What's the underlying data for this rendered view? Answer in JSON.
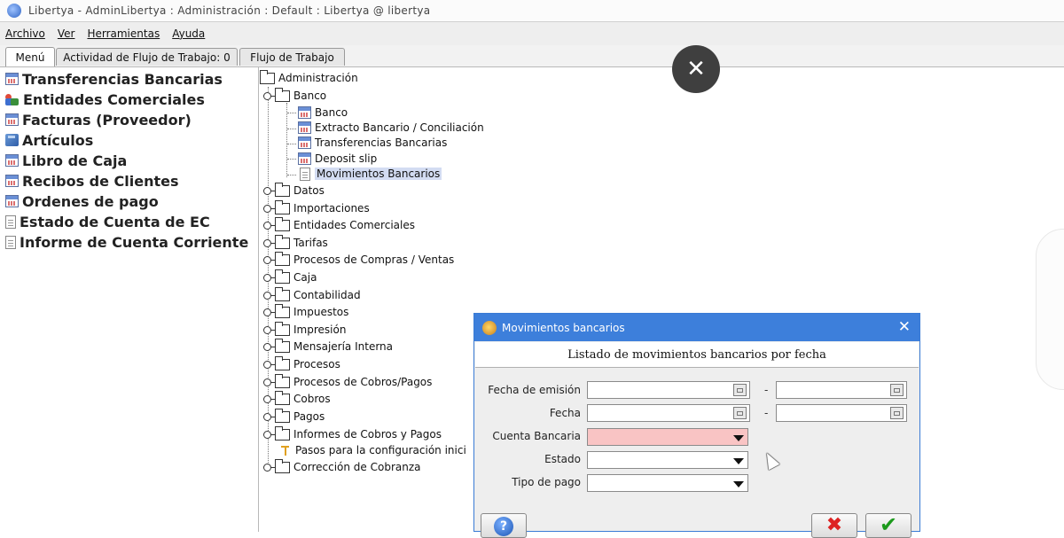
{
  "window": {
    "title": "Libertya    -    AdminLibertya : Administración : Default : Libertya @ libertya"
  },
  "menubar": {
    "items": [
      "Archivo",
      "Ver",
      "Herramientas",
      "Ayuda"
    ]
  },
  "tabs": [
    {
      "label": "Menú",
      "active": true
    },
    {
      "label": "Actividad de Flujo de Trabajo: 0",
      "active": false
    },
    {
      "label": "Flujo de Trabajo",
      "active": false
    }
  ],
  "favorites": [
    {
      "label": "Transferencias Bancarias",
      "icon": "window-icon"
    },
    {
      "label": "Entidades Comerciales",
      "icon": "entities-icon"
    },
    {
      "label": "Facturas (Proveedor)",
      "icon": "window-icon"
    },
    {
      "label": "Artículos",
      "icon": "product-icon"
    },
    {
      "label": "Libro de Caja",
      "icon": "window-icon"
    },
    {
      "label": "Recibos de Clientes",
      "icon": "window-icon"
    },
    {
      "label": "Ordenes de pago",
      "icon": "window-icon"
    },
    {
      "label": "Estado de Cuenta de EC",
      "icon": "report-icon"
    },
    {
      "label": "Informe de Cuenta Corriente",
      "icon": "report-icon"
    }
  ],
  "tree": {
    "root": "Administración",
    "banco": {
      "label": "Banco",
      "children": [
        "Banco",
        "Extracto Bancario / Conciliación",
        "Transferencias Bancarias",
        "Deposit slip",
        "Movimientos Bancarios"
      ]
    },
    "folders": [
      "Datos",
      "Importaciones",
      "Entidades Comerciales",
      "Tarifas",
      "Procesos de Compras / Ventas",
      "Caja",
      "Contabilidad",
      "Impuestos",
      "Impresión",
      "Mensajería Interna",
      "Procesos",
      "Procesos de Cobros/Pagos",
      "Cobros",
      "Pagos",
      "Informes de Cobros y Pagos"
    ],
    "pasos": "Pasos para la configuración inici",
    "correccion": "Corrección de Cobranza"
  },
  "overlay": {
    "close_glyph": "✕"
  },
  "dialog": {
    "title": "Movimientos bancarios",
    "close_glyph": "✕",
    "header": "Listado de movimientos bancarios por fecha",
    "labels": {
      "fecha_emision": "Fecha de emisión",
      "fecha": "Fecha",
      "cuenta_bancaria": "Cuenta Bancaria",
      "estado": "Estado",
      "tipo_pago": "Tipo de pago"
    },
    "dash": "-",
    "buttons": {
      "help_glyph": "?",
      "cancel_glyph": "✖",
      "ok_glyph": "✔"
    },
    "colors": {
      "title_bar": "#3d7fdb",
      "required_field": "#f9c4c4"
    }
  }
}
